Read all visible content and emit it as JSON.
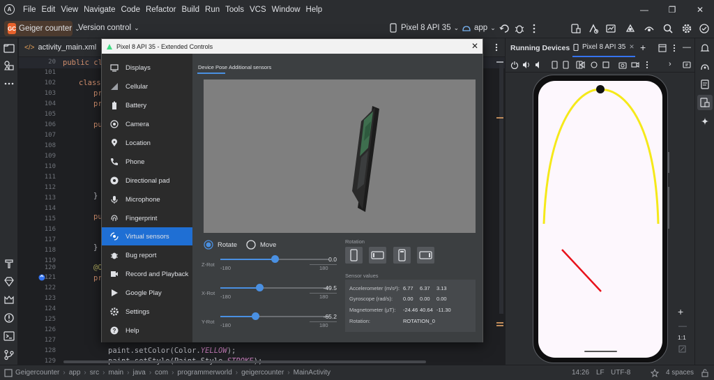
{
  "menubar": {
    "logo": "A",
    "items": [
      "File",
      "Edit",
      "View",
      "Navigate",
      "Code",
      "Refactor",
      "Build",
      "Run",
      "Tools",
      "VCS",
      "Window",
      "Help"
    ]
  },
  "toolbar": {
    "project_badge": "GC",
    "project_name": "Geiger counter",
    "version_control": "Version control",
    "device": "Pixel 8 API 35",
    "run_config": "app"
  },
  "editor": {
    "tab_label": "activity_main.xml",
    "line_numbers": [
      "20",
      "101",
      "102",
      "103",
      "104",
      "105",
      "106",
      "107",
      "108",
      "109",
      "110",
      "111",
      "112",
      "113",
      "114",
      "115",
      "116",
      "117",
      "118",
      "119",
      "120",
      "121",
      "122",
      "123",
      "124",
      "125",
      "126",
      "127",
      "128",
      "129",
      "130"
    ],
    "visible_code": {
      "line20": "public cla",
      "line102": "class",
      "line103": "pr",
      "line104": "pr",
      "line106": "pu",
      "line113": "}",
      "line115": "pu",
      "line118": "}",
      "line120": "@O",
      "line121": "pr",
      "line129_a": "paint.setColor(Color.",
      "line129_b": "YELLOW",
      "line129_c": ");",
      "line130_a": "paint.setStyle(Paint.Style.",
      "line130_b": "STROKE",
      "line130_c": ");"
    }
  },
  "dialog": {
    "title": "Pixel 8 API 35 - Extended Controls",
    "sidebar": [
      {
        "label": "Displays",
        "icon": "display-icon"
      },
      {
        "label": "Cellular",
        "icon": "cellular-icon"
      },
      {
        "label": "Battery",
        "icon": "battery-icon"
      },
      {
        "label": "Camera",
        "icon": "camera-icon"
      },
      {
        "label": "Location",
        "icon": "location-icon"
      },
      {
        "label": "Phone",
        "icon": "phone-icon"
      },
      {
        "label": "Directional pad",
        "icon": "dpad-icon"
      },
      {
        "label": "Microphone",
        "icon": "microphone-icon"
      },
      {
        "label": "Fingerprint",
        "icon": "fingerprint-icon"
      },
      {
        "label": "Virtual sensors",
        "icon": "sensors-icon",
        "active": true
      },
      {
        "label": "Bug report",
        "icon": "bug-icon"
      },
      {
        "label": "Record and Playback",
        "icon": "record-icon"
      },
      {
        "label": "Google Play",
        "icon": "play-icon"
      },
      {
        "label": "Settings",
        "icon": "settings-icon"
      },
      {
        "label": "Help",
        "icon": "help-icon"
      }
    ],
    "tabs": {
      "device_pose": "Device Pose",
      "additional_sensors": "Additional sensors"
    },
    "mode": {
      "rotate": "Rotate",
      "move": "Move",
      "selected": "rotate"
    },
    "sliders": [
      {
        "label": "Z-Rot",
        "min": "-180",
        "max": "180",
        "value": "0.0",
        "fraction": 0.5
      },
      {
        "label": "X-Rot",
        "min": "-180",
        "max": "180",
        "value": "-49.5",
        "fraction": 0.36
      },
      {
        "label": "Y-Rot",
        "min": "-180",
        "max": "180",
        "value": "-65.2",
        "fraction": 0.32
      }
    ],
    "rotation_label": "Rotation",
    "sensor_values": {
      "title": "Sensor values",
      "rows": [
        {
          "label": "Accelerometer (m/s²):",
          "v": [
            "6.77",
            "6.37",
            "3.13"
          ]
        },
        {
          "label": "Gyroscope (rad/s):",
          "v": [
            "0.00",
            "0.00",
            "0.00"
          ]
        },
        {
          "label": "Magnetometer (µT):",
          "v": [
            "-24.46",
            "40.64",
            "-11.30"
          ]
        },
        {
          "label": "Rotation:",
          "v": [
            "ROTATION_0"
          ]
        }
      ]
    }
  },
  "running_devices": {
    "title": "Running Devices",
    "device_tab": "Pixel 8 API 35",
    "zoom_label": "1:1",
    "screen_colors": {
      "arc": "#f5e91a",
      "line": "#e8121b",
      "ball": "#111111",
      "background": "#fdf7fd"
    }
  },
  "statusbar": {
    "breadcrumbs": [
      "Geigercounter",
      "app",
      "src",
      "main",
      "java",
      "com",
      "programmerworld",
      "geigercounter",
      "MainActivity"
    ],
    "position": "14:26",
    "line_sep": "LF",
    "encoding": "UTF-8",
    "indent": "4 spaces"
  },
  "colors": {
    "accent": "#1f6fd4",
    "slider": "#4a90e2",
    "orange": "#e8622c"
  }
}
